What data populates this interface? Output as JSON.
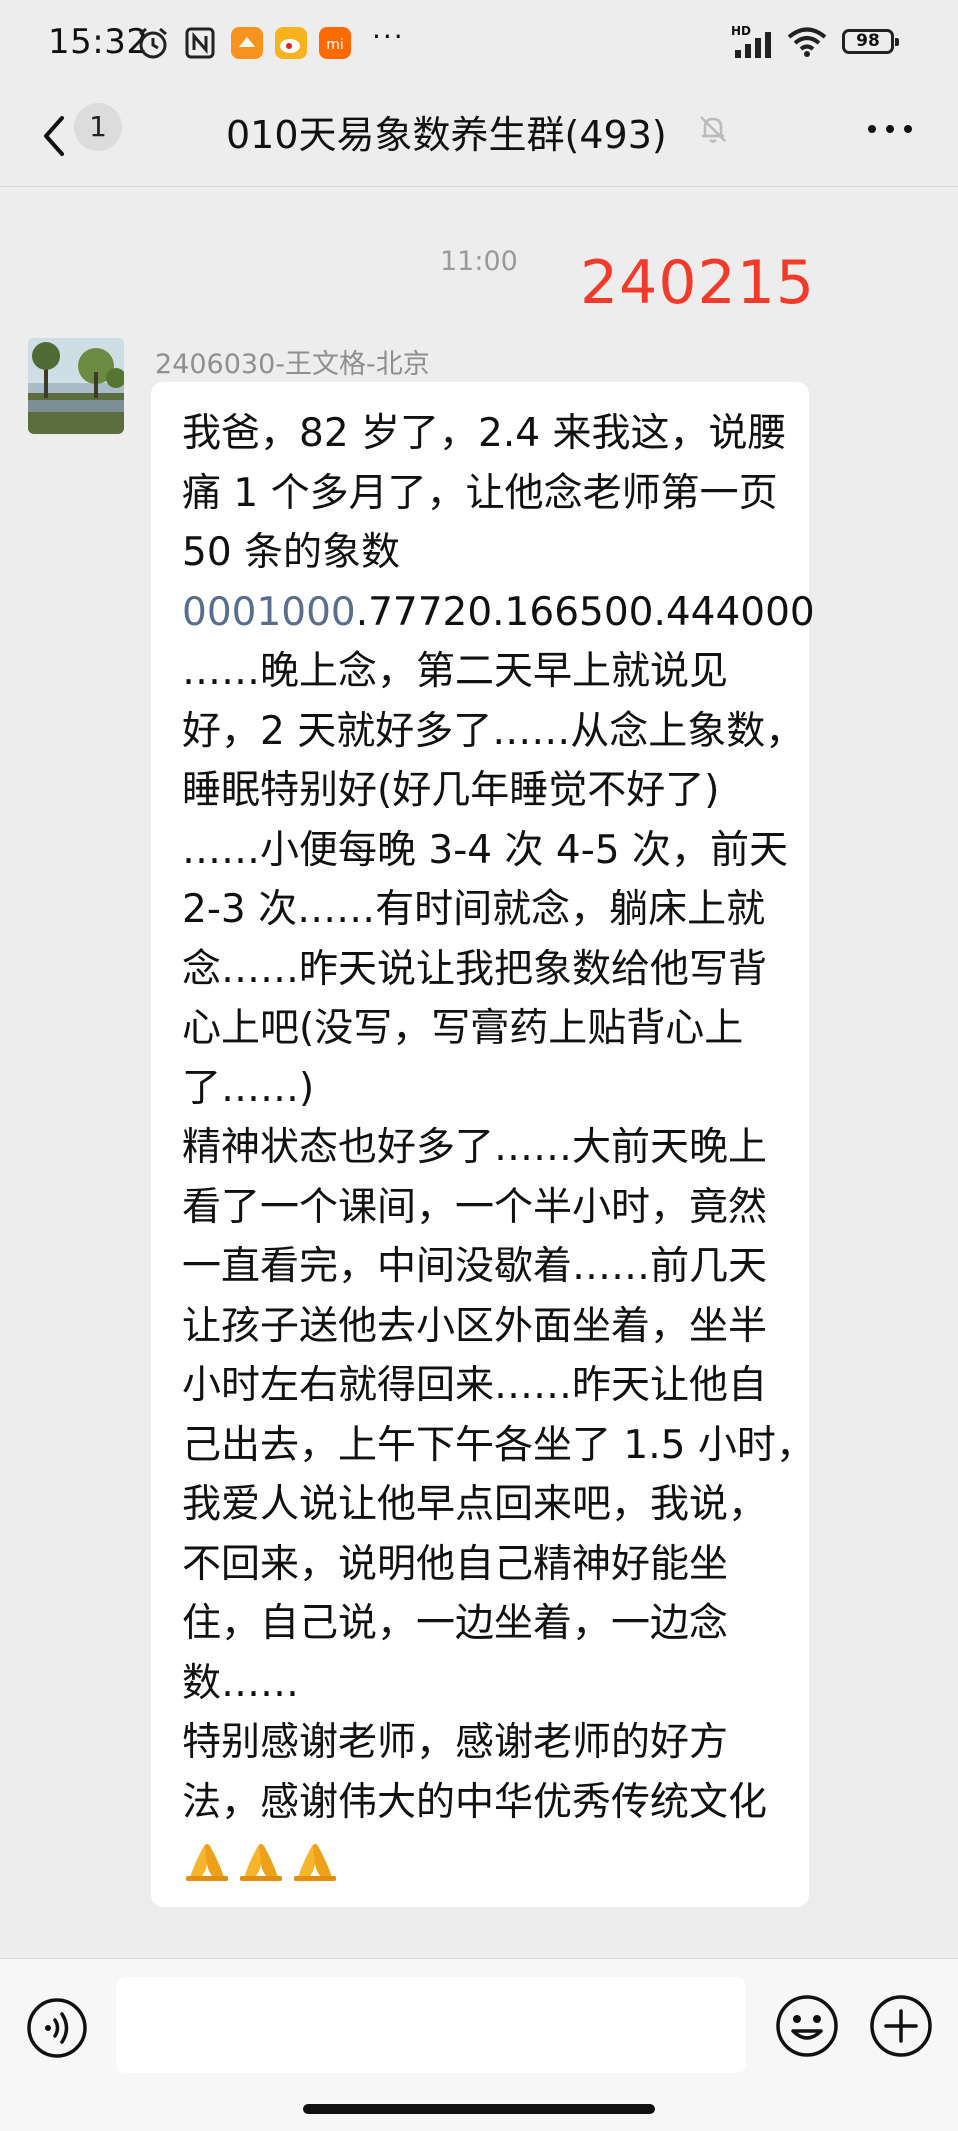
{
  "status_bar": {
    "time": "15:32",
    "left_icons": [
      "alarm-icon",
      "nfc-icon",
      "app-orange-icon",
      "weibo-icon",
      "mi-icon"
    ],
    "more_dots": "···",
    "network_label": "HD",
    "battery_level": "98"
  },
  "header": {
    "back_icon": "chevron-left-icon",
    "unread_count": "1",
    "title": "010天易象数养生群(493)",
    "mute_icon": "bell-muted-icon",
    "more_icon": "more-horizontal-icon"
  },
  "conversation": {
    "timestamp": "11:00",
    "overlay_number": "240215",
    "message": {
      "sender_name": "2406030-王文格-北京",
      "lines": [
        "我爸，82 岁了，2.4 来我这，说腰",
        "痛 1 个多月了，让他念老师第一页",
        "50 条的象数",
        "……晚上念，第二天早上就说见",
        "好，2 天就好多了……从念上象数，",
        "睡眠特别好(好几年睡觉不好了)",
        "……小便每晚 3-4 次 4-5 次，前天",
        "2-3 次……有时间就念，躺床上就",
        "念……昨天说让我把象数给他写背",
        "心上吧(没写，写膏药上贴背心上",
        "了……)",
        "精神状态也好多了……大前天晚上",
        "看了一个课间，一个半小时，竟然",
        "一直看完，中间没歇着……前几天",
        "让孩子送他去小区外面坐着，坐半",
        "小时左右就得回来……昨天让他自",
        "己出去，上午下午各坐了 1.5 小时，",
        "我爱人说让他早点回来吧，我说，",
        "不回来，说明他自己精神好能坐",
        "住，自己说，一边坐着，一边念",
        "数……",
        "特别感谢老师，感谢老师的好方",
        "法，感谢伟大的中华优秀传统文化"
      ],
      "number_line": {
        "highlight": "0001000",
        "rest": ".77720.166500.444000"
      },
      "emojis": [
        "folded-hands-icon",
        "folded-hands-icon",
        "folded-hands-icon"
      ]
    }
  },
  "bottom_bar": {
    "voice_icon": "voice-icon",
    "input_value": "",
    "emoji_icon": "emoji-icon",
    "plus_icon": "plus-icon"
  },
  "colors": {
    "background": "#ededed",
    "bubble": "#ffffff",
    "overlay_red": "#f23a2b",
    "link_blue": "#596d8c"
  }
}
